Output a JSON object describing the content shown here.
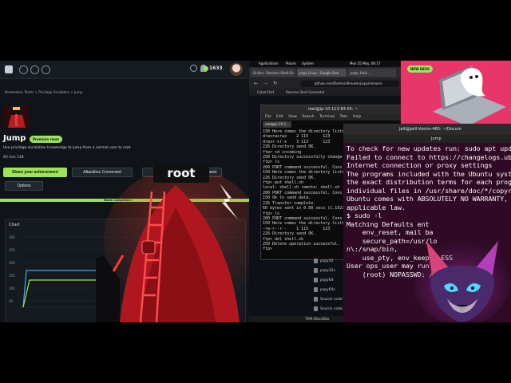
{
  "thm": {
    "points": "1633",
    "breadcrumb": "Penetration Tester  >  Privilege Escalation  >  Jump",
    "room_title": "Jump",
    "badge": "Premium room",
    "description": "Use privilege escalation knowledge to jump from a normal user to root.",
    "stats": "60 min   118",
    "share_button": "Share your achievement",
    "attackbox_button": "Attackbox Connected",
    "command_button": "mmand",
    "options_button": "Options",
    "progress_text": "Room completed (",
    "progress_fraction": 1.0,
    "chart_tab": "Chart",
    "chart_yticks": [
      "300",
      "250",
      "200",
      "150",
      "100",
      "50"
    ]
  },
  "illustration": {
    "root_label": "root"
  },
  "topbar": {
    "items": [
      "Applications",
      "Places",
      "System"
    ],
    "clock": "Mon 25 May, 06:17"
  },
  "browser": {
    "tabs": [
      "Online - Reverse Shell Ge",
      "pspy Linux - Google Sear",
      "pspy: Unix..."
    ],
    "url": "github.com/DominicBreuker/pspy/releases",
    "bookmarks": [
      "CyberChef",
      "Reverse Shell Generator"
    ]
  },
  "term1": {
    "title": "root@ip-10-113-83-55: ~",
    "menu": [
      "File",
      "Edit",
      "View",
      "Search",
      "Terminal",
      "Tabs",
      "Help"
    ],
    "tab": "root@ip-10-1...",
    "lines": [
      "150 Here comes the directory listi",
      "drwxrwxrwx    2 115      123",
      "drwxr-xr-x    3 113      123",
      "226 Directory send OK.",
      "ftp> cd incoming",
      "250 Directory successfully change",
      "ftp> ls",
      "200 PORT command successful. Cons",
      "150 Here comes the directory listi",
      "226 Directory send OK.",
      "ftp> put shell.sh",
      "local: shell.sh remote: shell.sh",
      "200 PORT command successful. Cons",
      "150 Ok to send data.",
      "226 Transfer complete.",
      "60 bytes sent in 0.00 secs (1.1921",
      "ftp> ls",
      "200 PORT command successful. Cons",
      "150 Here comes the directory listi",
      "-rw-r--r--    1 115      123",
      "226 Directory send OK.",
      "ftp> del shell.sh",
      "250 Delete operation successful.",
      "ftp> "
    ]
  },
  "files": {
    "items": [
      "pspy32",
      "pspy32s",
      "pspy64",
      "pspy64s",
      "Source code",
      "Source code"
    ],
    "taskbar": "THM AttackBox"
  },
  "term2": {
    "title": "jalil@jalil-Vostro-460: ~/Docum",
    "menu": [
      "Jump"
    ],
    "lines": [
      "To check for new updates run: sudo apt upda",
      "Failed to connect to https://changelogs.ubu",
      "Internet connection or proxy settings",
      "",
      "",
      "",
      "The programs included with the Ubuntu syste",
      "the exact distribution terms for each progr",
      "individual files in /usr/share/doc/*/copyri",
      "",
      "Ubuntu comes with ABSOLUTELY NO WARRANTY, t",
      "applicable law.",
      "",
      "$ sudo -l",
      "Matching Defaults ent",
      "    env_reset, mail ba",
      "    secure_path=/usr/lo",
      "n\\:/snap/bin,",
      "    use_pty, env_keep+=LESS",
      "",
      "User ops_user may run the",
      "    (root) NOPASSWD: /usr/"
    ]
  },
  "promo": {
    "tag": "NEW DEVS"
  }
}
